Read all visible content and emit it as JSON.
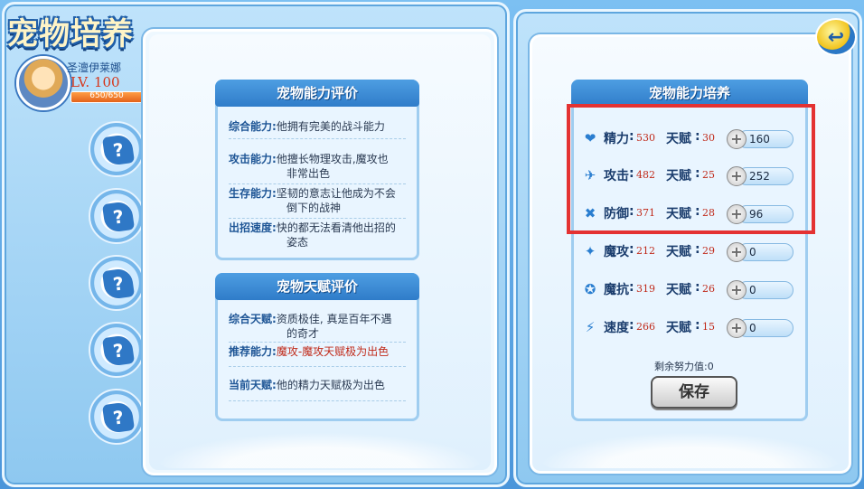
{
  "header": {
    "title": "宠物培养"
  },
  "pet": {
    "name": "圣澶伊莱娜",
    "level": "LV. 100",
    "hp_text": "650/650",
    "hp_fraction": 1.0
  },
  "slots": [
    {
      "icon": "question-icon",
      "glyph": "?"
    },
    {
      "icon": "question-icon",
      "glyph": "?"
    },
    {
      "icon": "question-icon",
      "glyph": "?"
    },
    {
      "icon": "question-icon",
      "glyph": "?"
    },
    {
      "icon": "question-icon",
      "glyph": "?"
    }
  ],
  "ability_eval": {
    "title": "宠物能力评价",
    "rows": [
      {
        "label": "综合能力:",
        "value": "他拥有完美的战斗能力"
      },
      {
        "label": "攻击能力:",
        "value": "他擅长物理攻击,魔攻也",
        "value2": "非常出色"
      },
      {
        "label": "生存能力:",
        "value": "坚韧的意志让他成为不会",
        "value2": "倒下的战神"
      },
      {
        "label": "出招速度:",
        "value": "快的都无法看清他出招的",
        "value2": "姿态"
      }
    ]
  },
  "talent_eval": {
    "title": "宠物天赋评价",
    "rows": [
      {
        "label": "综合天赋:",
        "value": "资质极佳, 真是百年不遇",
        "value2": "的奇才"
      },
      {
        "label": "推荐能力:",
        "value": "魔攻-魔攻天赋极为出色",
        "red": true
      },
      {
        "label": "当前天赋:",
        "value": "他的精力天赋极为出色"
      }
    ]
  },
  "training": {
    "title": "宠物能力培养",
    "talent_label": "天赋",
    "stats": [
      {
        "icon": "heart-icon",
        "glyph": "❤",
        "name": "精力",
        "value": "530",
        "talent": "30",
        "effort": "160"
      },
      {
        "icon": "sword-icon",
        "glyph": "✈",
        "name": "攻击",
        "value": "482",
        "talent": "25",
        "effort": "252"
      },
      {
        "icon": "shield-icon",
        "glyph": "✖",
        "name": "防御",
        "value": "371",
        "talent": "28",
        "effort": "96"
      },
      {
        "icon": "magic-attack-icon",
        "glyph": "✦",
        "name": "魔攻",
        "value": "212",
        "talent": "29",
        "effort": "0"
      },
      {
        "icon": "magic-defense-icon",
        "glyph": "✪",
        "name": "魔抗",
        "value": "319",
        "talent": "26",
        "effort": "0"
      },
      {
        "icon": "speed-icon",
        "glyph": "⚡",
        "name": "速度",
        "value": "266",
        "talent": "15",
        "effort": "0"
      }
    ],
    "remaining_label": "剩余努力值:",
    "remaining_value": "0",
    "save_label": "保存"
  },
  "colors": {
    "accent": "#2f7cc9",
    "highlight": "#e43232",
    "value_red": "#c02a1a"
  }
}
